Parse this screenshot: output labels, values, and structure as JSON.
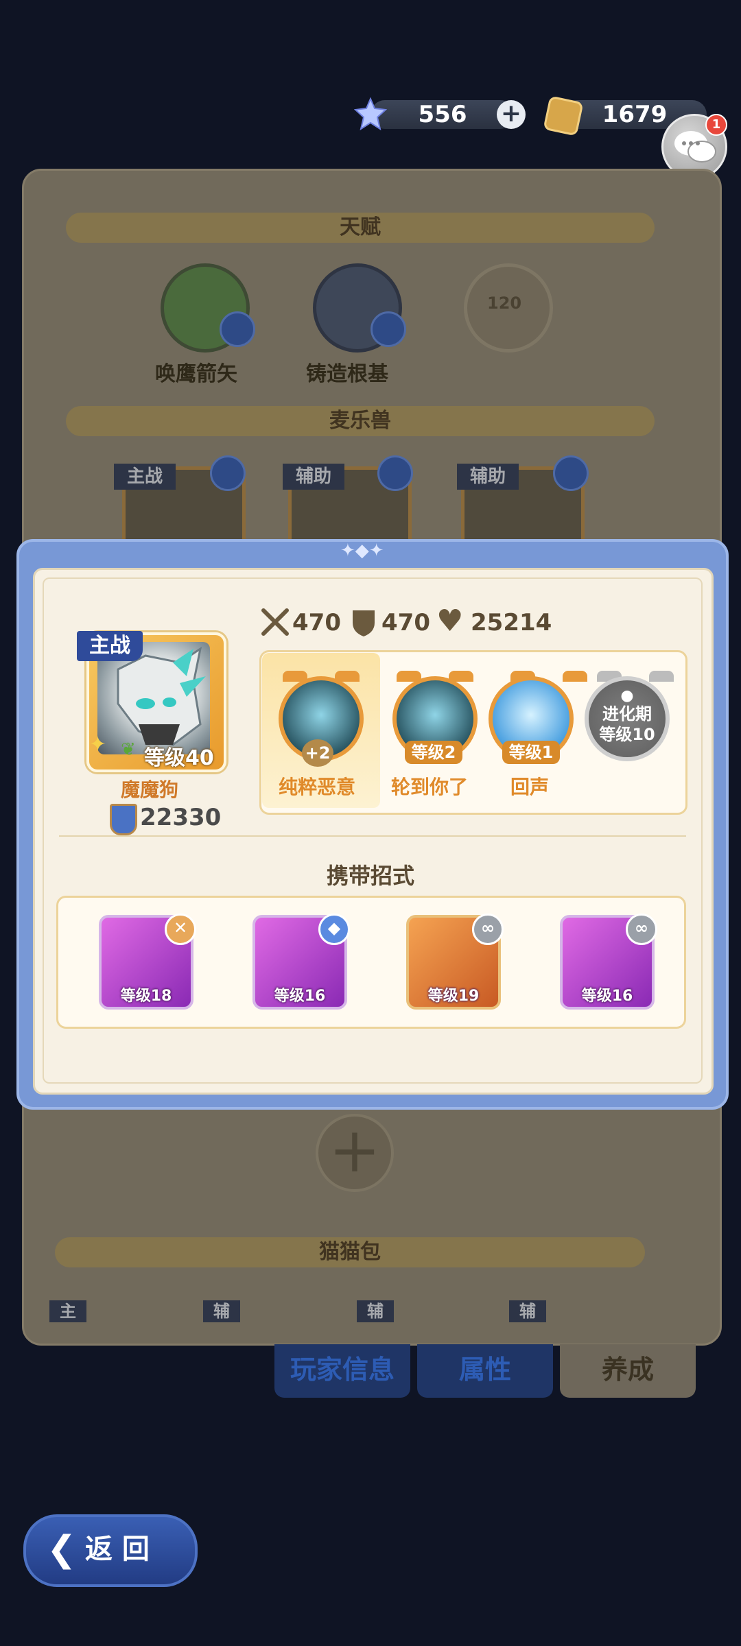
{
  "currency": {
    "gems": "556",
    "coins": "1679",
    "chat_badge": "1"
  },
  "background": {
    "talent_title": "天赋",
    "talents": [
      "唤鹰箭矢",
      "铸造根基",
      "120"
    ],
    "pets_title": "麦乐兽",
    "pet_tags": [
      "主战",
      "辅助",
      "辅助"
    ],
    "bag_title": "猫猫包",
    "bag_tags": [
      "主",
      "辅",
      "辅",
      "辅"
    ],
    "tabs": [
      "玩家信息",
      "属性",
      "养成"
    ],
    "back_label": "返 回"
  },
  "popup": {
    "hero": {
      "tag": "主战",
      "level": "等级40",
      "name": "魔魔狗",
      "power": "22330"
    },
    "stats": {
      "attack": "470",
      "defense": "470",
      "hp": "25214"
    },
    "skills": [
      {
        "name": "纯粹恶意",
        "badge": "+2"
      },
      {
        "name": "轮到你了",
        "level": "等级2"
      },
      {
        "name": "回声",
        "level": "等级1"
      },
      {
        "locked_line1": "进化期",
        "locked_line2": "等级10"
      }
    ],
    "moves_title": "携带招式",
    "moves": [
      {
        "level": "等级18",
        "badge": "✕"
      },
      {
        "level": "等级16",
        "badge": "◆"
      },
      {
        "level": "等级19",
        "badge": "∞"
      },
      {
        "level": "等级16",
        "badge": "∞"
      }
    ]
  },
  "colors": {
    "popup_frame": "#7898d6",
    "popup_bg": "#f7f1e4",
    "accent_orange": "#e08a2a",
    "tab_blue": "#2d5cb4"
  }
}
